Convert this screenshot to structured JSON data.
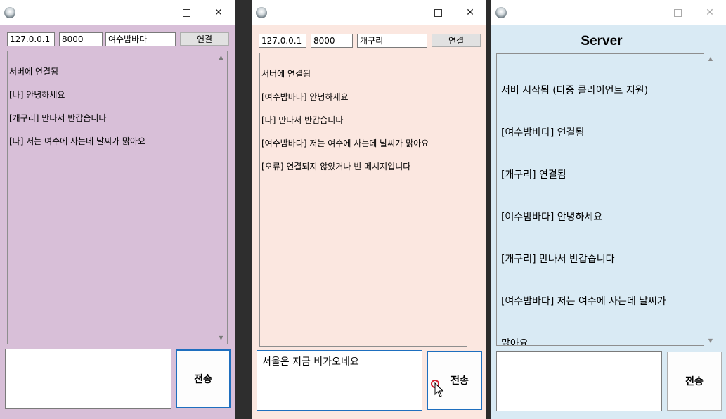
{
  "colors": {
    "window1_bg": "#d8bfd8",
    "window2_bg": "#fbe7e0",
    "window3_bg": "#d9eaf4",
    "focus_border": "#1e6fbf",
    "cursor_ring": "#d2202f"
  },
  "client1": {
    "ip": "127.0.0.1",
    "port": "8000",
    "nickname": "여수밤바다",
    "connect_label": "연결",
    "log": [
      "서버에 연결됨",
      "[나] 안녕하세요",
      "[개구리] 만나서 반갑습니다",
      "[나] 저는 여수에 사는데 날씨가 맑아요"
    ],
    "message": "",
    "send_label": "전송"
  },
  "client2": {
    "ip": "127.0.0.1",
    "port": "8000",
    "nickname": "개구리",
    "connect_label": "연결",
    "log": [
      "서버에 연결됨",
      "[여수밤바다] 안녕하세요",
      "[나] 만나서 반갑습니다",
      "[여수밤바다] 저는 여수에 사는데 날씨가 맑아요",
      "[오류] 연결되지 않았거나 빈 메시지입니다"
    ],
    "message": "서울은 지금 비가오네요",
    "send_label": "전송"
  },
  "server": {
    "title": "Server",
    "log": [
      "서버 시작됨 (다중 클라이언트 지원)",
      "[여수밤바다] 연결됨",
      "[개구리] 연결됨",
      "[여수밤바다] 안녕하세요",
      "[개구리] 만나서 반갑습니다",
      "[여수밤바다] 저는 여수에 사는데 날씨가",
      "맑아요"
    ],
    "message": "",
    "send_label": "전송"
  },
  "window_controls": {
    "minimize": "—",
    "maximize": "☐",
    "close": "✕"
  }
}
